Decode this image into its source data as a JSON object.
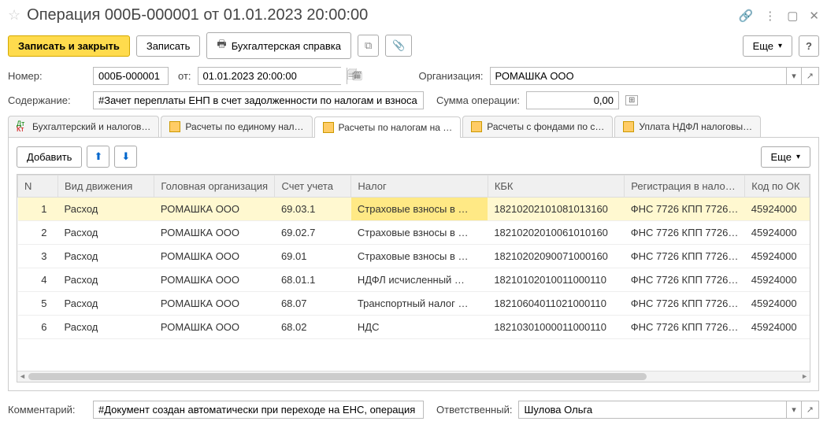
{
  "title": "Операция 000Б-000001 от 01.01.2023 20:00:00",
  "toolbar": {
    "save_close": "Записать и закрыть",
    "save": "Записать",
    "print_ref": "Бухгалтерская справка",
    "more": "Еще"
  },
  "form": {
    "number_label": "Номер:",
    "number": "000Б-000001",
    "from_label": "от:",
    "date": "01.01.2023 20:00:00",
    "org_label": "Организация:",
    "org": "РОМАШКА ООО",
    "content_label": "Содержание:",
    "content": "#Зачет переплаты ЕНП в счет задолженности по налогам и взноса",
    "sum_label": "Сумма операции:",
    "sum": "0,00"
  },
  "tabs": [
    "Бухгалтерский и налогов…",
    "Расчеты по единому нал…",
    "Расчеты по налогам на …",
    "Расчеты с фондами по с…",
    "Уплата НДФЛ налоговы…"
  ],
  "table": {
    "add": "Добавить",
    "more": "Еще",
    "headers": {
      "n": "N",
      "move": "Вид движения",
      "org": "Головная организация",
      "acct": "Счет учета",
      "tax": "Налог",
      "kbk": "КБК",
      "reg": "Регистрация в налого…",
      "code": "Код по ОК"
    },
    "rows": [
      {
        "n": "1",
        "move": "Расход",
        "org": "РОМАШКА ООО",
        "acct": "69.03.1",
        "tax": "Страховые взносы в …",
        "kbk": "18210202101081013160",
        "reg": "ФНС 7726 КПП 77260…",
        "code": "45924000"
      },
      {
        "n": "2",
        "move": "Расход",
        "org": "РОМАШКА ООО",
        "acct": "69.02.7",
        "tax": "Страховые взносы в …",
        "kbk": "18210202010061010160",
        "reg": "ФНС 7726 КПП 77260…",
        "code": "45924000"
      },
      {
        "n": "3",
        "move": "Расход",
        "org": "РОМАШКА ООО",
        "acct": "69.01",
        "tax": "Страховые взносы в …",
        "kbk": "18210202090071000160",
        "reg": "ФНС 7726 КПП 77260…",
        "code": "45924000"
      },
      {
        "n": "4",
        "move": "Расход",
        "org": "РОМАШКА ООО",
        "acct": "68.01.1",
        "tax": "НДФЛ исчисленный …",
        "kbk": "18210102010011000110",
        "reg": "ФНС 7726 КПП 77260…",
        "code": "45924000"
      },
      {
        "n": "5",
        "move": "Расход",
        "org": "РОМАШКА ООО",
        "acct": "68.07",
        "tax": "Транспортный налог …",
        "kbk": "18210604011021000110",
        "reg": "ФНС 7726 КПП 77260…",
        "code": "45924000"
      },
      {
        "n": "6",
        "move": "Расход",
        "org": "РОМАШКА ООО",
        "acct": "68.02",
        "tax": "НДС",
        "kbk": "18210301000011000110",
        "reg": "ФНС 7726 КПП 77260…",
        "code": "45924000"
      }
    ]
  },
  "footer": {
    "comment_label": "Комментарий:",
    "comment": "#Документ создан автоматически при переходе на ЕНС, операция",
    "resp_label": "Ответственный:",
    "resp": "Шулова Ольга"
  }
}
